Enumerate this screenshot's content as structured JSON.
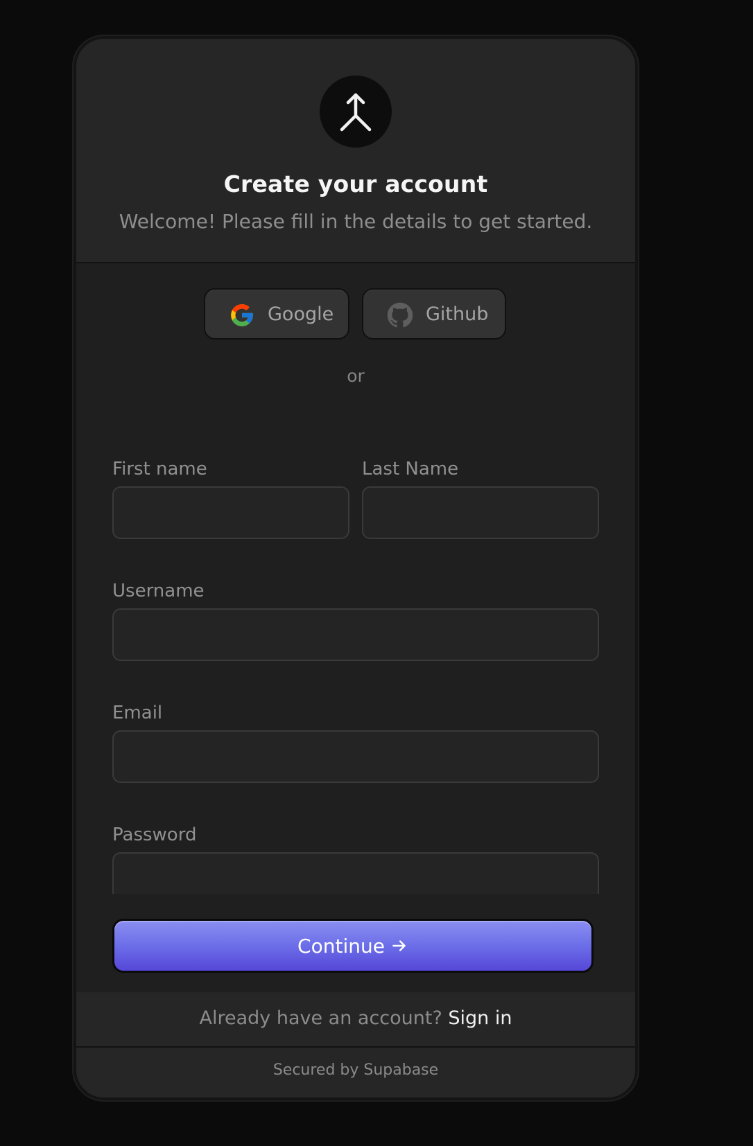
{
  "header": {
    "logo_icon": "merge-arrow-icon",
    "title": "Create your account",
    "subtitle": "Welcome! Please fill in the details to get started."
  },
  "social": {
    "google_label": "Google",
    "github_label": "Github"
  },
  "divider_text": "or",
  "form": {
    "first_name_label": "First name",
    "first_name_value": "",
    "last_name_label": "Last Name",
    "last_name_value": "",
    "username_label": "Username",
    "username_value": "",
    "email_label": "Email",
    "email_value": "",
    "password_label": "Password",
    "password_value": ""
  },
  "continue_label": "Continue",
  "footer": {
    "prompt": "Already have an account?",
    "sign_in_link": "Sign in",
    "secured_by": "Secured by Supabase"
  },
  "colors": {
    "accent_top": "#8a8ef0",
    "accent_bottom": "#5547d8",
    "background": "#0b0b0b",
    "card": "#252525"
  }
}
